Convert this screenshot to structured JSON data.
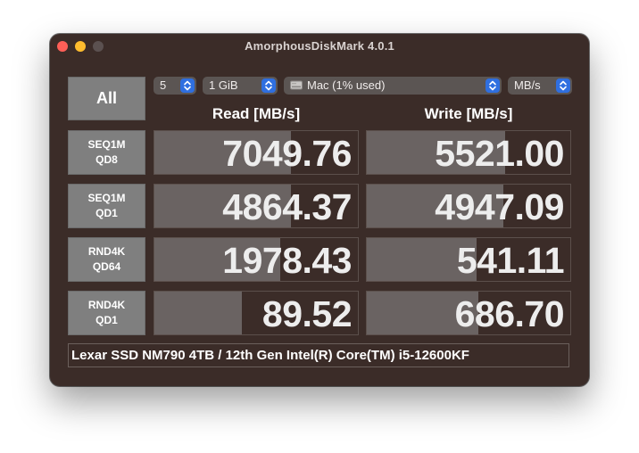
{
  "window": {
    "title": "AmorphousDiskMark 4.0.1"
  },
  "toolbar": {
    "all_label": "All",
    "count": "5",
    "size": "1 GiB",
    "drive": "Mac (1% used)",
    "unit": "MB/s"
  },
  "columns": {
    "read": "Read [MB/s]",
    "write": "Write [MB/s]"
  },
  "rows": [
    {
      "line1": "SEQ1M",
      "line2": "QD8",
      "read": "7049.76",
      "write": "5521.00",
      "read_fill": 0.67,
      "write_fill": 0.68
    },
    {
      "line1": "SEQ1M",
      "line2": "QD1",
      "read": "4864.37",
      "write": "4947.09",
      "read_fill": 0.67,
      "write_fill": 0.67
    },
    {
      "line1": "RND4K",
      "line2": "QD64",
      "read": "1978.43",
      "write": "541.11",
      "read_fill": 0.62,
      "write_fill": 0.54
    },
    {
      "line1": "RND4K",
      "line2": "QD1",
      "read": "89.52",
      "write": "686.70",
      "read_fill": 0.43,
      "write_fill": 0.55
    }
  ],
  "footer": {
    "text": "Lexar SSD NM790 4TB / 12th Gen Intel(R) Core(TM) i5-12600KF"
  },
  "colors": {
    "window_bg": "#3b2c28",
    "label_bg": "#7f7f7f",
    "bar_fill": "#6a6362",
    "accent": "#2f6fe0"
  },
  "icons": {
    "close": "close-icon",
    "minimize": "minimize-icon",
    "zoom": "zoom-icon",
    "stepper": "chevron-updown-icon",
    "drive": "drive-icon"
  }
}
